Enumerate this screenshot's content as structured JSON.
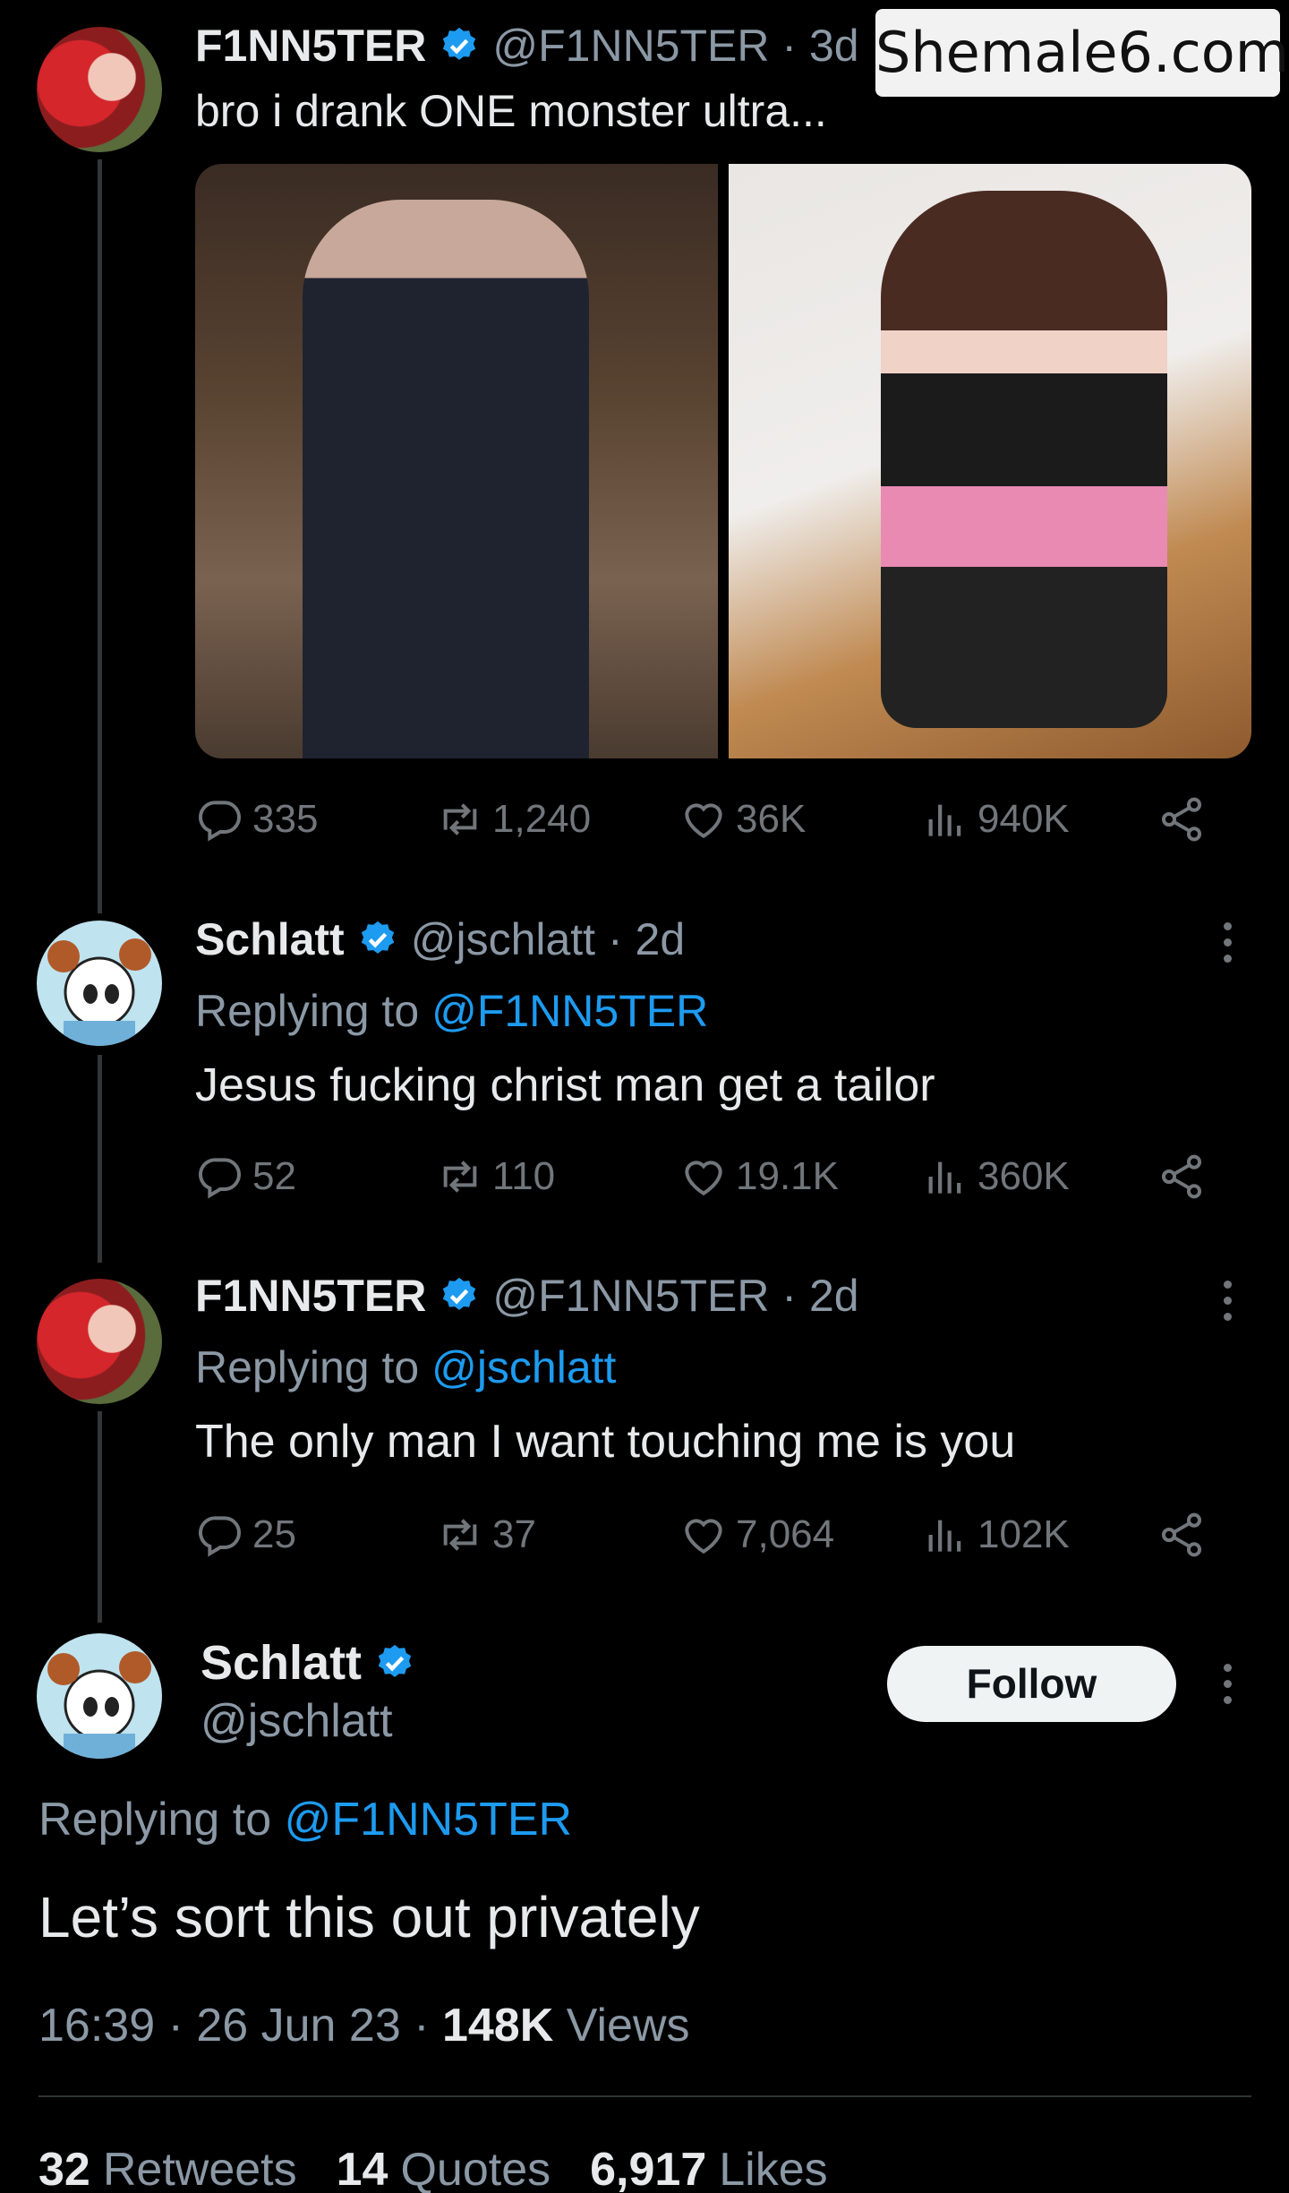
{
  "watermark": "Shemale6.com",
  "tweets": [
    {
      "name": "F1NN5TER",
      "handle": "@F1NN5TER · 3d",
      "text": "bro i drank ONE monster ultra...",
      "replies": "335",
      "retweets": "1,240",
      "likes": "36K",
      "views": "940K"
    },
    {
      "name": "Schlatt",
      "handle": "@jschlatt · 2d",
      "replying_label": "Replying to",
      "replying_to": "@F1NN5TER",
      "text": "Jesus fucking christ man get a tailor",
      "replies": "52",
      "retweets": "110",
      "likes": "19.1K",
      "views": "360K"
    },
    {
      "name": "F1NN5TER",
      "handle": "@F1NN5TER · 2d",
      "replying_label": "Replying to",
      "replying_to": "@jschlatt",
      "text": "The only man I want touching me is you",
      "replies": "25",
      "retweets": "37",
      "likes": "7,064",
      "views": "102K"
    }
  ],
  "main": {
    "name": "Schlatt",
    "handle": "@jschlatt",
    "follow_label": "Follow",
    "replying_label": "Replying to",
    "replying_to": "@F1NN5TER",
    "text": "Let’s sort this out privately",
    "time": "16:39 · 26 Jun 23 · ",
    "views_count": "148K",
    "views_label": " Views",
    "retweets_count": "32",
    "retweets_label": "Retweets",
    "quotes_count": "14",
    "quotes_label": "Quotes",
    "likes_count": "6,917",
    "likes_label": "Likes"
  },
  "colors": {
    "background": "#000000",
    "accent": "#1d9bf0",
    "muted": "#71767b"
  },
  "icons": [
    "verified-icon",
    "reply-icon",
    "retweet-icon",
    "like-icon",
    "views-icon",
    "share-icon",
    "more-icon"
  ]
}
